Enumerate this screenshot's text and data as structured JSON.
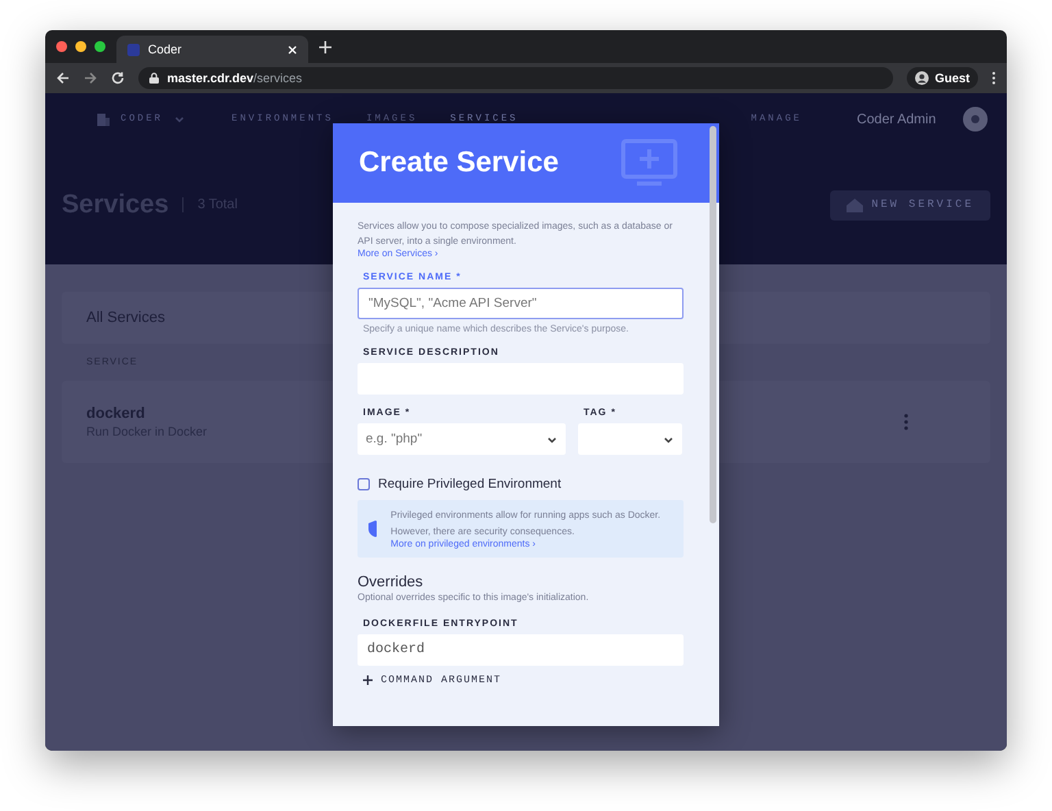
{
  "browser": {
    "tab_title": "Coder",
    "url_host": "master.cdr.dev",
    "url_path": "/services",
    "profile": "Guest"
  },
  "nav": {
    "org": "CODER",
    "items": [
      {
        "label": "ENVIRONMENTS",
        "selected": false
      },
      {
        "label": "IMAGES",
        "selected": false
      },
      {
        "label": "SERVICES",
        "selected": true
      },
      {
        "label": "MANAGE",
        "selected": false
      }
    ],
    "user": "Coder Admin"
  },
  "page": {
    "title": "Services",
    "count": "3 Total",
    "new_button": "NEW SERVICE",
    "card_title": "All Services",
    "column": "SERVICE",
    "rows": [
      {
        "name": "dockerd",
        "description": "Run Docker in Docker"
      }
    ]
  },
  "modal": {
    "title": "Create Service",
    "intro": "Services allow you to compose specialized images, such as a database or API server, into a single environment.",
    "intro_link": "More on Services ›",
    "name_field": {
      "label": "SERVICE NAME *",
      "placeholder": "\"MySQL\", \"Acme API Server\"",
      "help": "Specify a unique name which describes the Service's purpose.",
      "focused": true
    },
    "description_field": {
      "label": "SERVICE DESCRIPTION",
      "focused": false
    },
    "image_field": {
      "label": "IMAGE *",
      "placeholder": "e.g. \"php\""
    },
    "tag_field": {
      "label": "TAG *"
    },
    "privileged": {
      "label": "Require Privileged Environment",
      "checked": false
    },
    "info": {
      "text": "Privileged environments allow for running apps such as Docker. However, there are security consequences.",
      "link": "More on privileged environments ›"
    },
    "overrides": {
      "heading": "Overrides",
      "subtext": "Optional overrides specific to this image's initialization.",
      "entrypoint_label": "DOCKERFILE ENTRYPOINT",
      "entrypoint_value": "dockerd",
      "add_button": "COMMAND ARGUMENT"
    }
  }
}
